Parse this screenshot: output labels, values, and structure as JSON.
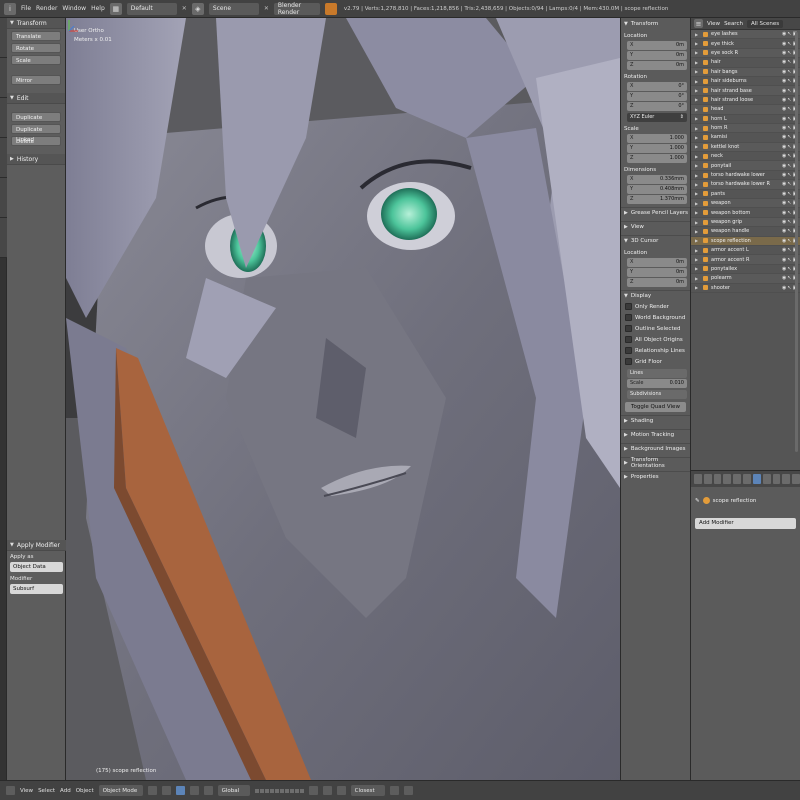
{
  "topbar": {
    "menus": [
      "File",
      "Render",
      "Window",
      "Help"
    ],
    "layout": "Default",
    "scene": "Scene",
    "engine": "Blender Render",
    "stats": "v2.79 | Verts:1,278,810 | Faces:1,218,856 | Tris:2,438,659 | Objects:0/94 | Lamps:0/4 | Mem:430.0M | scope reflection"
  },
  "toolshelf": {
    "transform_header": "Transform",
    "transform_buttons": [
      "Translate",
      "Rotate",
      "Scale",
      "Mirror"
    ],
    "edit_header": "Edit",
    "edit_buttons": [
      "Duplicate",
      "Duplicate Linked",
      "Delete"
    ],
    "history_header": "History",
    "operator": {
      "title": "Apply Modifier",
      "apply_as_label": "Apply as",
      "apply_as_value": "Object Data",
      "modifier_label": "Modifier",
      "modifier_value": "Subsurf"
    }
  },
  "viewport": {
    "view_label": "User Ortho",
    "units": "Meters x 0.01",
    "object_label": "(175) scope reflection"
  },
  "npanel": {
    "transform_header": "Transform",
    "location_label": "Location",
    "location": [
      {
        "axis": "X",
        "value": "0m"
      },
      {
        "axis": "Y",
        "value": "0m"
      },
      {
        "axis": "Z",
        "value": "0m"
      }
    ],
    "rotation_label": "Rotation",
    "rotation": [
      {
        "axis": "X",
        "value": "0°"
      },
      {
        "axis": "Y",
        "value": "0°"
      },
      {
        "axis": "Z",
        "value": "0°"
      }
    ],
    "rotation_mode": "XYZ Euler",
    "scale_label": "Scale",
    "scale": [
      {
        "axis": "X",
        "value": "1.000"
      },
      {
        "axis": "Y",
        "value": "1.000"
      },
      {
        "axis": "Z",
        "value": "1.000"
      }
    ],
    "dimensions_label": "Dimensions",
    "dimensions": [
      {
        "axis": "X",
        "value": "0.336mm"
      },
      {
        "axis": "Y",
        "value": "0.408mm"
      },
      {
        "axis": "Z",
        "value": "1.370mm"
      }
    ],
    "grease_pencil": "Grease Pencil Layers",
    "view_header": "View",
    "cursor_header": "3D Cursor",
    "cursor_location_label": "Location",
    "cursor_location": [
      {
        "axis": "X",
        "value": "0m"
      },
      {
        "axis": "Y",
        "value": "0m"
      },
      {
        "axis": "Z",
        "value": "0m"
      }
    ],
    "display_header": "Display",
    "display_checks": [
      "Only Render",
      "World Background",
      "Outline Selected",
      "All Object Origins",
      "Relationship Lines",
      "Grid Floor"
    ],
    "grid": {
      "lines_label": "Lines",
      "scale_label": "Scale",
      "scale_value": "0.010",
      "subdivisions_label": "Subdivisions"
    },
    "toggle_quad": "Toggle Quad View",
    "more_headers": [
      "Shading",
      "Motion Tracking",
      "Background Images",
      "Transform Orientations",
      "Properties"
    ]
  },
  "outliner": {
    "view": "View",
    "search": "Search",
    "filter": "All Scenes",
    "items": [
      "eye lashes",
      "eye thick",
      "eye sock R",
      "hair",
      "hair bangs",
      "hair sideburns",
      "hair strand base",
      "hair strand loose",
      "head",
      "horn L",
      "horn R",
      "kamisi",
      "kettlel knot",
      "neck",
      "ponytail",
      "torso hardwake lower",
      "torso hardwake lower R",
      "pants",
      "weapon",
      "weapon bottom",
      "weapon grip",
      "weapon handle",
      "scope reflection",
      "armor accent L",
      "armor accent R",
      "ponytailex",
      "polearm",
      "shooter"
    ],
    "selected_index": 22
  },
  "properties": {
    "context_object": "scope reflection",
    "add_modifier": "Add Modifier"
  },
  "bottombar": {
    "menus": [
      "View",
      "Select",
      "Add",
      "Object"
    ],
    "mode": "Object Mode",
    "orientation": "Global",
    "snap": "Closest"
  }
}
